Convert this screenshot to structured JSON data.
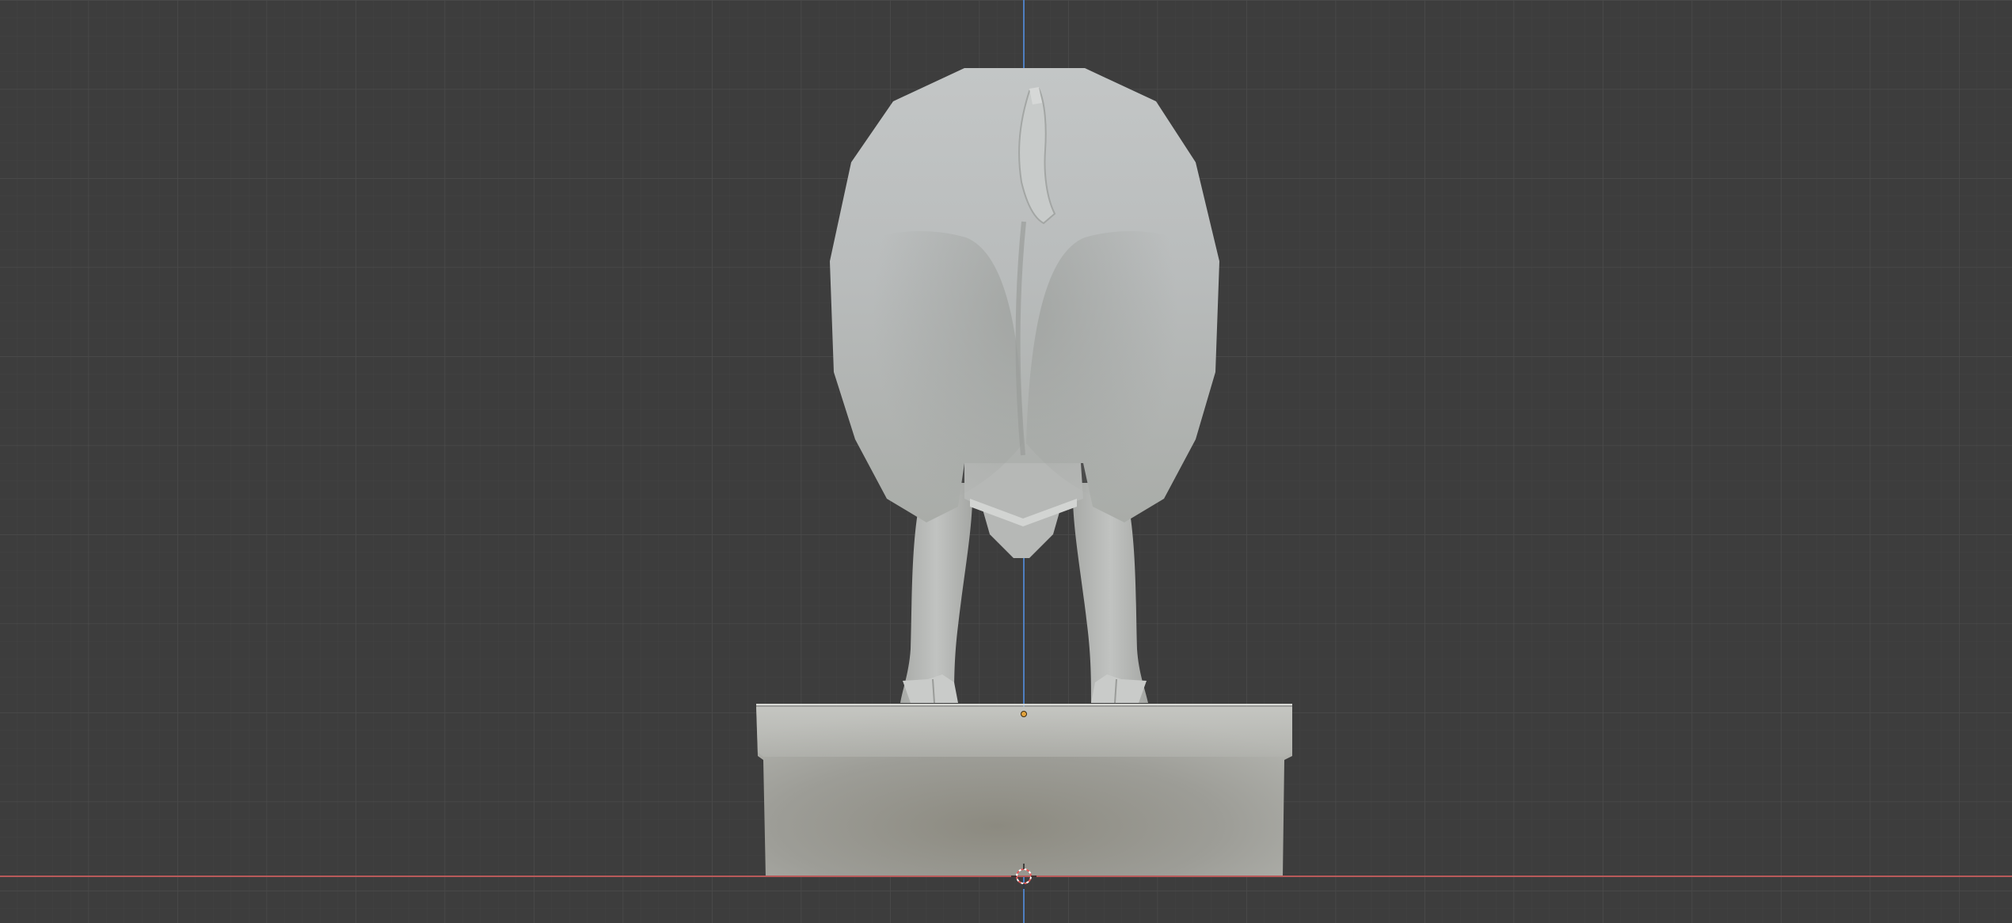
{
  "viewport": {
    "view": "back-orthographic",
    "background_color": "#3d3d3d",
    "grid_minor_color": "#454545",
    "grid_major_color": "#4a4a4a",
    "x_axis_color": "#b85a5a",
    "z_axis_color": "#4f7fc0"
  },
  "scene": {
    "model": "pig-on-pedestal",
    "model_color": "#b4b7b6",
    "pedestal_color": "#a7a7a2",
    "origin_marker_color": "#e2a33c",
    "cursor_color": "#e25a5a"
  }
}
